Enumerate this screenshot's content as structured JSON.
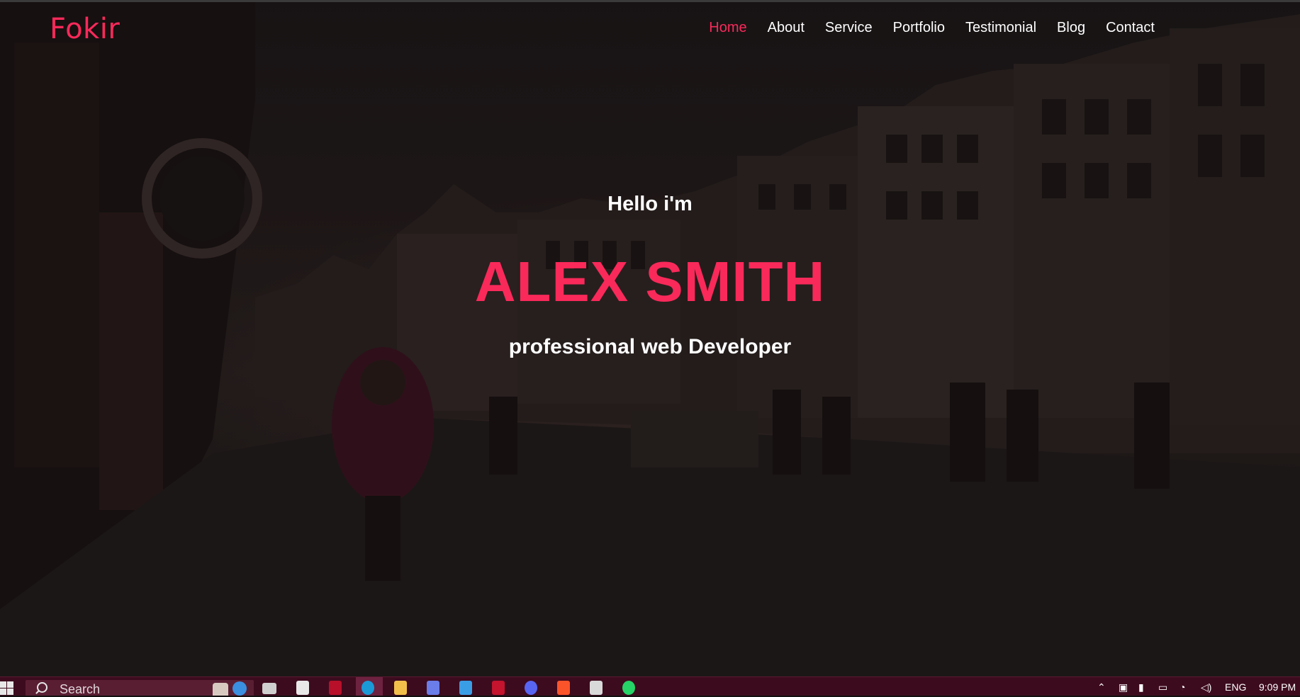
{
  "brand": {
    "logo": "Fokir"
  },
  "nav": {
    "items": [
      {
        "label": "Home",
        "active": true
      },
      {
        "label": "About",
        "active": false
      },
      {
        "label": "Service",
        "active": false
      },
      {
        "label": "Portfolio",
        "active": false
      },
      {
        "label": "Testimonial",
        "active": false
      },
      {
        "label": "Blog",
        "active": false
      },
      {
        "label": "Contact",
        "active": false
      }
    ]
  },
  "hero": {
    "greeting": "Hello i'm",
    "name": "ALEX SMITH",
    "role": "professional web Developer"
  },
  "taskbar": {
    "search_placeholder": "Search",
    "language": "ENG",
    "time": "9:09 PM"
  },
  "colors": {
    "accent": "#f9295a",
    "text": "#ffffff",
    "taskbar": "#3d0b1e"
  }
}
